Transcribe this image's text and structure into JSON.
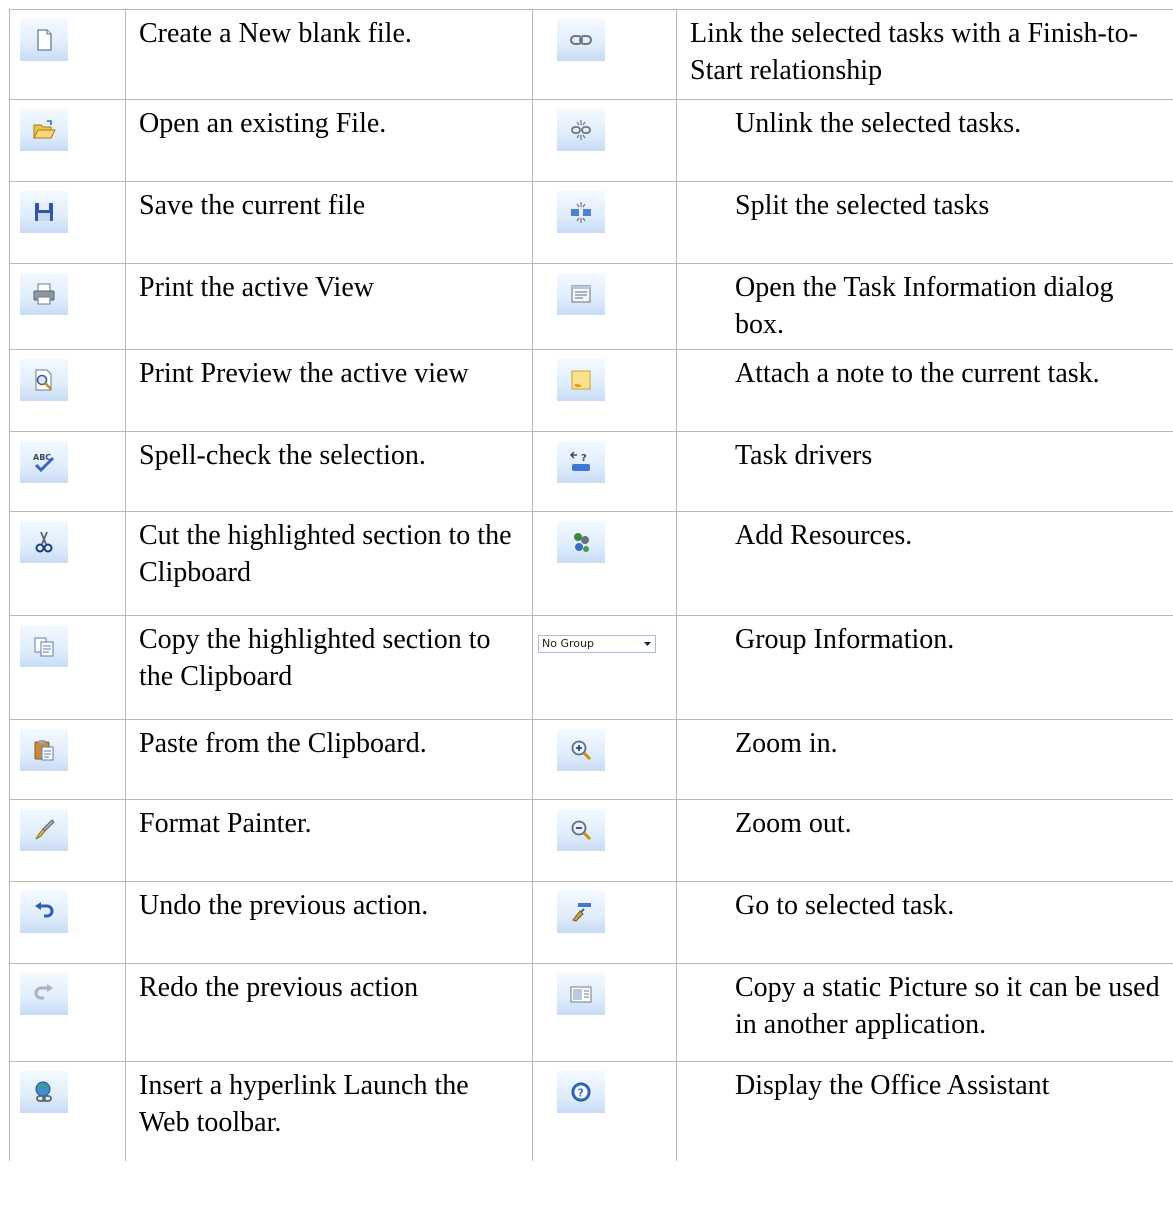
{
  "rows": [
    {
      "left": {
        "icon": "new-file-icon",
        "text": "Create a New blank file."
      },
      "right": {
        "icon": "link-tasks-icon",
        "text": "Link the selected tasks with a Finish-to-Start relationship"
      }
    },
    {
      "left": {
        "icon": "open-folder-icon",
        "text": "Open an existing File."
      },
      "right": {
        "icon": "unlink-tasks-icon",
        "text": "Unlink the selected tasks."
      }
    },
    {
      "left": {
        "icon": "save-disk-icon",
        "text": "Save the current file"
      },
      "right": {
        "icon": "split-task-icon",
        "text": "Split the selected tasks"
      }
    },
    {
      "left": {
        "icon": "printer-icon",
        "text": "Print the active View"
      },
      "right": {
        "icon": "task-information-icon",
        "text": "Open the Task Information dialog box."
      }
    },
    {
      "left": {
        "icon": "print-preview-icon",
        "text": "Print Preview the active view"
      },
      "right": {
        "icon": "task-note-icon",
        "text": "Attach a note to the current task."
      }
    },
    {
      "left": {
        "icon": "spell-check-icon",
        "text": "Spell-check the selection."
      },
      "right": {
        "icon": "task-drivers-icon",
        "text": "Task drivers"
      }
    },
    {
      "left": {
        "icon": "scissors-icon",
        "text": "Cut the highlighted section to the Clipboard"
      },
      "right": {
        "icon": "add-resources-icon",
        "text": "Add Resources."
      }
    },
    {
      "left": {
        "icon": "copy-icon",
        "text": "Copy the highlighted section to the Clipboard"
      },
      "right": {
        "icon": "group-dropdown",
        "text": "Group Information.",
        "dropdown_value": "No Group"
      }
    },
    {
      "left": {
        "icon": "paste-icon",
        "text": "Paste from the Clipboard."
      },
      "right": {
        "icon": "zoom-in-icon",
        "text": "Zoom in."
      }
    },
    {
      "left": {
        "icon": "format-painter-icon",
        "text": "Format Painter."
      },
      "right": {
        "icon": "zoom-out-icon",
        "text": "Zoom out."
      }
    },
    {
      "left": {
        "icon": "undo-icon",
        "text": "Undo the previous action."
      },
      "right": {
        "icon": "go-to-task-icon",
        "text": "Go to selected task."
      }
    },
    {
      "left": {
        "icon": "redo-icon",
        "text": "Redo the previous action"
      },
      "right": {
        "icon": "copy-picture-icon",
        "text": "Copy a static Picture so it can be used in another application."
      }
    },
    {
      "left": {
        "icon": "insert-hyperlink-icon",
        "text": "Insert a hyperlink Launch the Web toolbar."
      },
      "right": {
        "icon": "office-assistant-help-icon",
        "text": "Display the Office Assistant"
      }
    }
  ],
  "colors": {
    "icon_gradient_top": "#f4f9ff",
    "icon_gradient_bottom": "#c8dcf5",
    "grid": "#b8b8b8"
  }
}
